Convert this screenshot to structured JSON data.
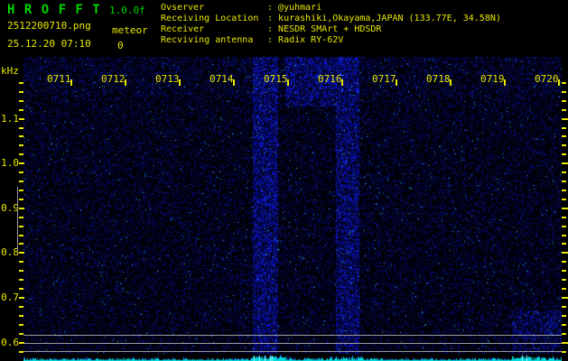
{
  "app": {
    "title": "H R O F F T",
    "version": "1.0.0f",
    "filename": "2512200710.png",
    "meteor_label": "meteor",
    "meteor_count": "0",
    "timestamp": "25.12.20 07:10"
  },
  "info": {
    "separator": ":",
    "rows": [
      {
        "label": "Ovserver",
        "value": "@yuhmari"
      },
      {
        "label": "Receiving Location",
        "value": "kurashiki,Okayama,JAPAN (133.77E, 34.58N)"
      },
      {
        "label": "Receiver",
        "value": "NESDR SMArt + HDSDR"
      },
      {
        "label": "Recviving antenna",
        "value": "Radix RY-62V"
      }
    ]
  },
  "spectrogram": {
    "unit_label": "kHz",
    "freq_axis": {
      "labels": [
        "1.1",
        "1.0",
        "0.9",
        "0.8",
        "0.7",
        "0.6"
      ]
    },
    "time_axis": {
      "labels": [
        "0711",
        "0712",
        "0713",
        "0714",
        "0715",
        "0716",
        "0717",
        "0718",
        "0719",
        "0720"
      ]
    },
    "colors": {
      "background": "#000000",
      "text_yellow": "#e8e800",
      "title_green": "#00d400",
      "noise_blue": "#2233ee",
      "marker_gray": "#9a9a9a",
      "signal_cyan": "#00dcdc"
    }
  }
}
